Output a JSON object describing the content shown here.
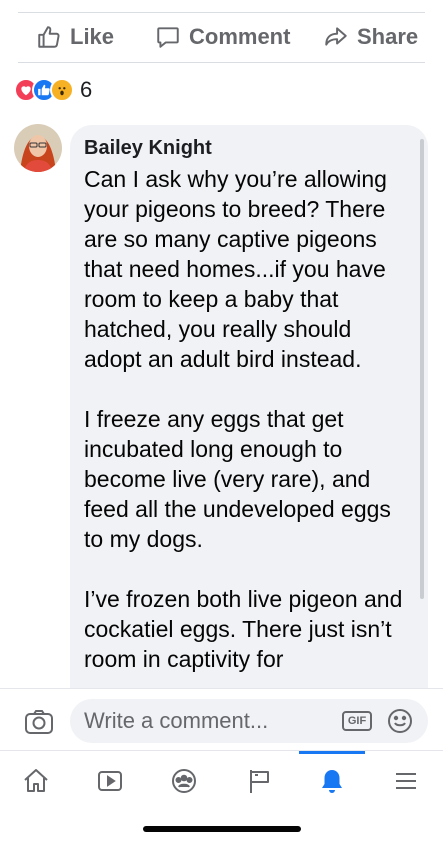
{
  "actions": {
    "like_label": "Like",
    "comment_label": "Comment",
    "share_label": "Share"
  },
  "reactions": {
    "types": [
      "love-icon",
      "like-icon",
      "wow-icon"
    ],
    "count": "6"
  },
  "comment": {
    "author": "Bailey Knight",
    "paragraphs": [
      "Can I ask why you’re allowing your pigeons to breed? There are so many captive pigeons that need homes...if you have room to keep a baby that hatched, you really should adopt an adult bird instead.",
      "I freeze any eggs that get incubated long enough to become live (very rare), and feed all the undeveloped eggs to my dogs.",
      "I’ve frozen both live pigeon and cockatiel eggs. There just isn’t room in captivity for"
    ]
  },
  "composer": {
    "placeholder": "Write a comment...",
    "gif_label": "GIF"
  },
  "tabs": [
    "home-icon",
    "video-icon",
    "groups-icon",
    "pages-flag-icon",
    "notifications-bell-icon",
    "menu-icon"
  ],
  "colors": {
    "accent": "#1877f2",
    "love": "#f33e58",
    "wow": "#f7b125",
    "bubble_bg": "#f0f2f5",
    "muted_text": "#65676b"
  }
}
